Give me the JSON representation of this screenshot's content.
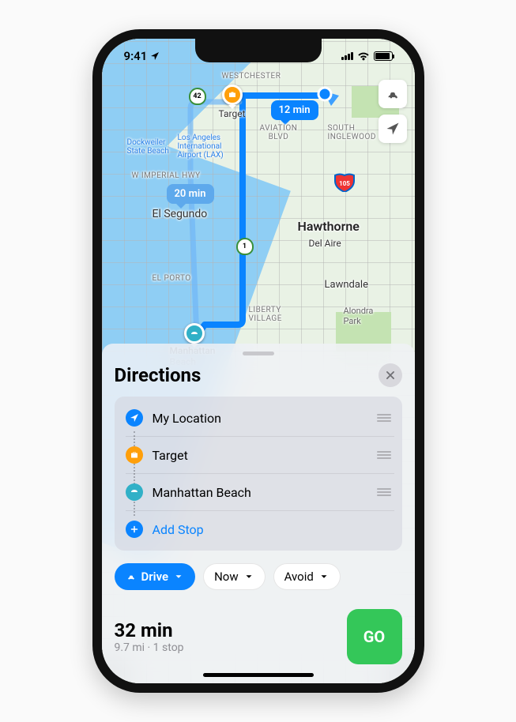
{
  "status": {
    "time": "9:41"
  },
  "map": {
    "badges": {
      "primary_eta": "12 min",
      "alternate_eta": "20 min"
    },
    "labels": {
      "westchester": "WESTCHESTER",
      "target": "Target",
      "aviation": "AVIATION\nBLVD",
      "south_inglewood": "SOUTH\nINGLEWOOD",
      "dockweiler": "Dockweiler\nState Beach",
      "lax": "Los Angeles\nInternational\nAirport (LAX)",
      "imp_hwy": "W IMPERIAL HWY",
      "el_segundo": "El Segundo",
      "hawthorne": "Hawthorne",
      "del_aire": "Del Aire",
      "el_porto": "EL PORTO",
      "lawndale": "Lawndale",
      "liberty": "LIBERTY\nVILLAGE",
      "alondra": "Alondra\nPark",
      "manhattan_bch": "Manhattan\nBeach"
    },
    "shields": {
      "s42": "42",
      "s1": "1",
      "i105": "105"
    }
  },
  "sheet": {
    "title": "Directions",
    "stops": [
      {
        "icon": "loc",
        "label": "My Location",
        "draggable": true
      },
      {
        "icon": "targ",
        "label": "Target",
        "draggable": true
      },
      {
        "icon": "dest",
        "label": "Manhattan Beach",
        "draggable": true
      },
      {
        "icon": "add",
        "label": "Add Stop",
        "draggable": false,
        "accent": true
      }
    ],
    "mode_pills": {
      "drive": "Drive",
      "now": "Now",
      "avoid": "Avoid"
    },
    "eta": {
      "time": "32 min",
      "sub": "9.7 mi · 1 stop"
    },
    "go": "GO"
  }
}
